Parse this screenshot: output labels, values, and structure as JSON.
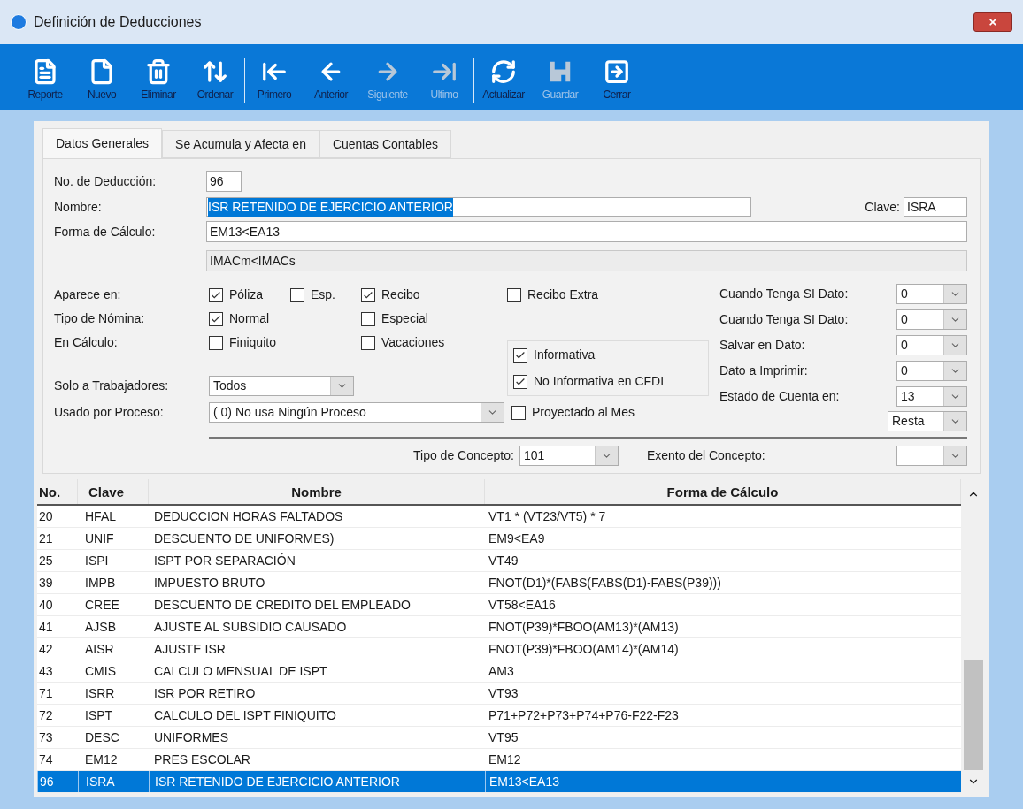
{
  "window": {
    "title": "Definición de Deducciones",
    "close": "×"
  },
  "toolbar": {
    "groups": [
      [
        {
          "label": "Reporte",
          "disabled": false
        },
        {
          "label": "Nuevo",
          "disabled": false
        },
        {
          "label": "Eliminar",
          "disabled": false
        },
        {
          "label": "Ordenar",
          "disabled": false
        }
      ],
      [
        {
          "label": "Primero",
          "disabled": false
        },
        {
          "label": "Anterior",
          "disabled": false
        },
        {
          "label": "Siguiente",
          "disabled": true
        },
        {
          "label": "Ultimo",
          "disabled": true
        }
      ],
      [
        {
          "label": "Actualizar",
          "disabled": false
        },
        {
          "label": "Guardar",
          "disabled": true
        },
        {
          "label": "Cerrar",
          "disabled": false
        }
      ]
    ]
  },
  "tabs": [
    {
      "label": "Datos Generales",
      "selected": true
    },
    {
      "label": "Se Acumula y Afecta en",
      "selected": false
    },
    {
      "label": "Cuentas Contables",
      "selected": false
    }
  ],
  "form": {
    "numero": {
      "label": "No. de Deducción:",
      "value": "96"
    },
    "nombre": {
      "label": "Nombre:",
      "value": "ISR RETENIDO DE EJERCICIO ANTERIOR",
      "highlighted": true
    },
    "clave": {
      "label": "Clave:",
      "value": "ISRA"
    },
    "forma": {
      "label": "Forma de Cálculo:",
      "value": "EM13<EA13"
    },
    "forma_2": {
      "value": "IMACm<IMACs"
    },
    "aparece_en": {
      "label": "Aparece en:",
      "options": [
        {
          "label": "Póliza",
          "checked": true
        },
        {
          "label": "Esp.",
          "checked": false
        },
        {
          "label": "Recibo",
          "checked": true
        },
        {
          "label": "Recibo Extra",
          "checked": false
        }
      ]
    },
    "tipo_nomina": {
      "label": "Tipo de Nómina:",
      "options": [
        {
          "label": "Normal",
          "checked": true
        },
        {
          "label": "Especial",
          "checked": false
        }
      ]
    },
    "en_calculo": {
      "label": "En Cálculo:",
      "options": [
        {
          "label": "Finiquito",
          "checked": false
        },
        {
          "label": "Vacaciones",
          "checked": false
        }
      ]
    },
    "informativa": [
      {
        "label": "Informativa",
        "checked": true
      },
      {
        "label": "No Informativa en CFDI",
        "checked": true
      }
    ],
    "solo_trabajadores": {
      "label": "Solo a Trabajadores:",
      "value": "Todos"
    },
    "usado_por_proceso": {
      "label": "Usado por Proceso:",
      "value": "( 0) No usa Ningún Proceso"
    },
    "proyectado": {
      "label": "Proyectado al Mes",
      "checked": false
    },
    "right_fields": [
      {
        "label": "Cuando Tenga SI Dato:",
        "value": "0"
      },
      {
        "label": "Cuando Tenga SI Dato:",
        "value": "0"
      },
      {
        "label": "Salvar en Dato:",
        "value": "0"
      },
      {
        "label": "Dato a Imprimir:",
        "value": "0"
      },
      {
        "label": "Estado de Cuenta en:",
        "value": "13"
      }
    ],
    "operacion": {
      "value": "Resta"
    },
    "tipo_concepto": {
      "label": "Tipo de Concepto:",
      "value": "101"
    },
    "exento": {
      "label": "Exento del Concepto:"
    }
  },
  "table": {
    "columns": [
      "No.",
      "Clave",
      "Nombre",
      "Forma de Cálculo"
    ],
    "rows": [
      {
        "cells": [
          "20",
          "HFAL",
          "DEDUCCION HORAS FALTADOS",
          "VT1 * (VT23/VT5) * 7"
        ],
        "selected": false
      },
      {
        "cells": [
          "21",
          "UNIF",
          "DESCUENTO DE UNIFORMES)",
          "EM9<EA9"
        ],
        "selected": false
      },
      {
        "cells": [
          "25",
          "ISPI",
          "ISPT POR SEPARACIÓN",
          "VT49"
        ],
        "selected": false
      },
      {
        "cells": [
          "39",
          "IMPB",
          "IMPUESTO BRUTO",
          "FNOT(D1)*(FABS(FABS(D1)-FABS(P39)))"
        ],
        "selected": false
      },
      {
        "cells": [
          "40",
          "CREE",
          "DESCUENTO DE CREDITO DEL EMPLEADO",
          "VT58<EA16"
        ],
        "selected": false
      },
      {
        "cells": [
          "41",
          "AJSB",
          "AJUSTE AL SUBSIDIO CAUSADO",
          "FNOT(P39)*FBOO(AM13)*(AM13)"
        ],
        "selected": false
      },
      {
        "cells": [
          "42",
          "AISR",
          "AJUSTE ISR",
          "FNOT(P39)*FBOO(AM14)*(AM14)"
        ],
        "selected": false
      },
      {
        "cells": [
          "43",
          "CMIS",
          "CALCULO MENSUAL DE ISPT",
          "AM3"
        ],
        "selected": false
      },
      {
        "cells": [
          "71",
          "ISRR",
          "ISR POR RETIRO",
          "VT93"
        ],
        "selected": false
      },
      {
        "cells": [
          "72",
          "ISPT",
          "CALCULO DEL ISPT FINIQUITO",
          "P71+P72+P73+P74+P76-F22-F23"
        ],
        "selected": false
      },
      {
        "cells": [
          "73",
          "DESC",
          "UNIFORMES",
          "VT95"
        ],
        "selected": false
      },
      {
        "cells": [
          "74",
          "EM12",
          "PRES ESCOLAR",
          "EM12"
        ],
        "selected": false
      },
      {
        "cells": [
          "96",
          "ISRA",
          "ISR RETENIDO DE EJERCICIO ANTERIOR",
          "EM13<EA13"
        ],
        "selected": true
      }
    ]
  }
}
